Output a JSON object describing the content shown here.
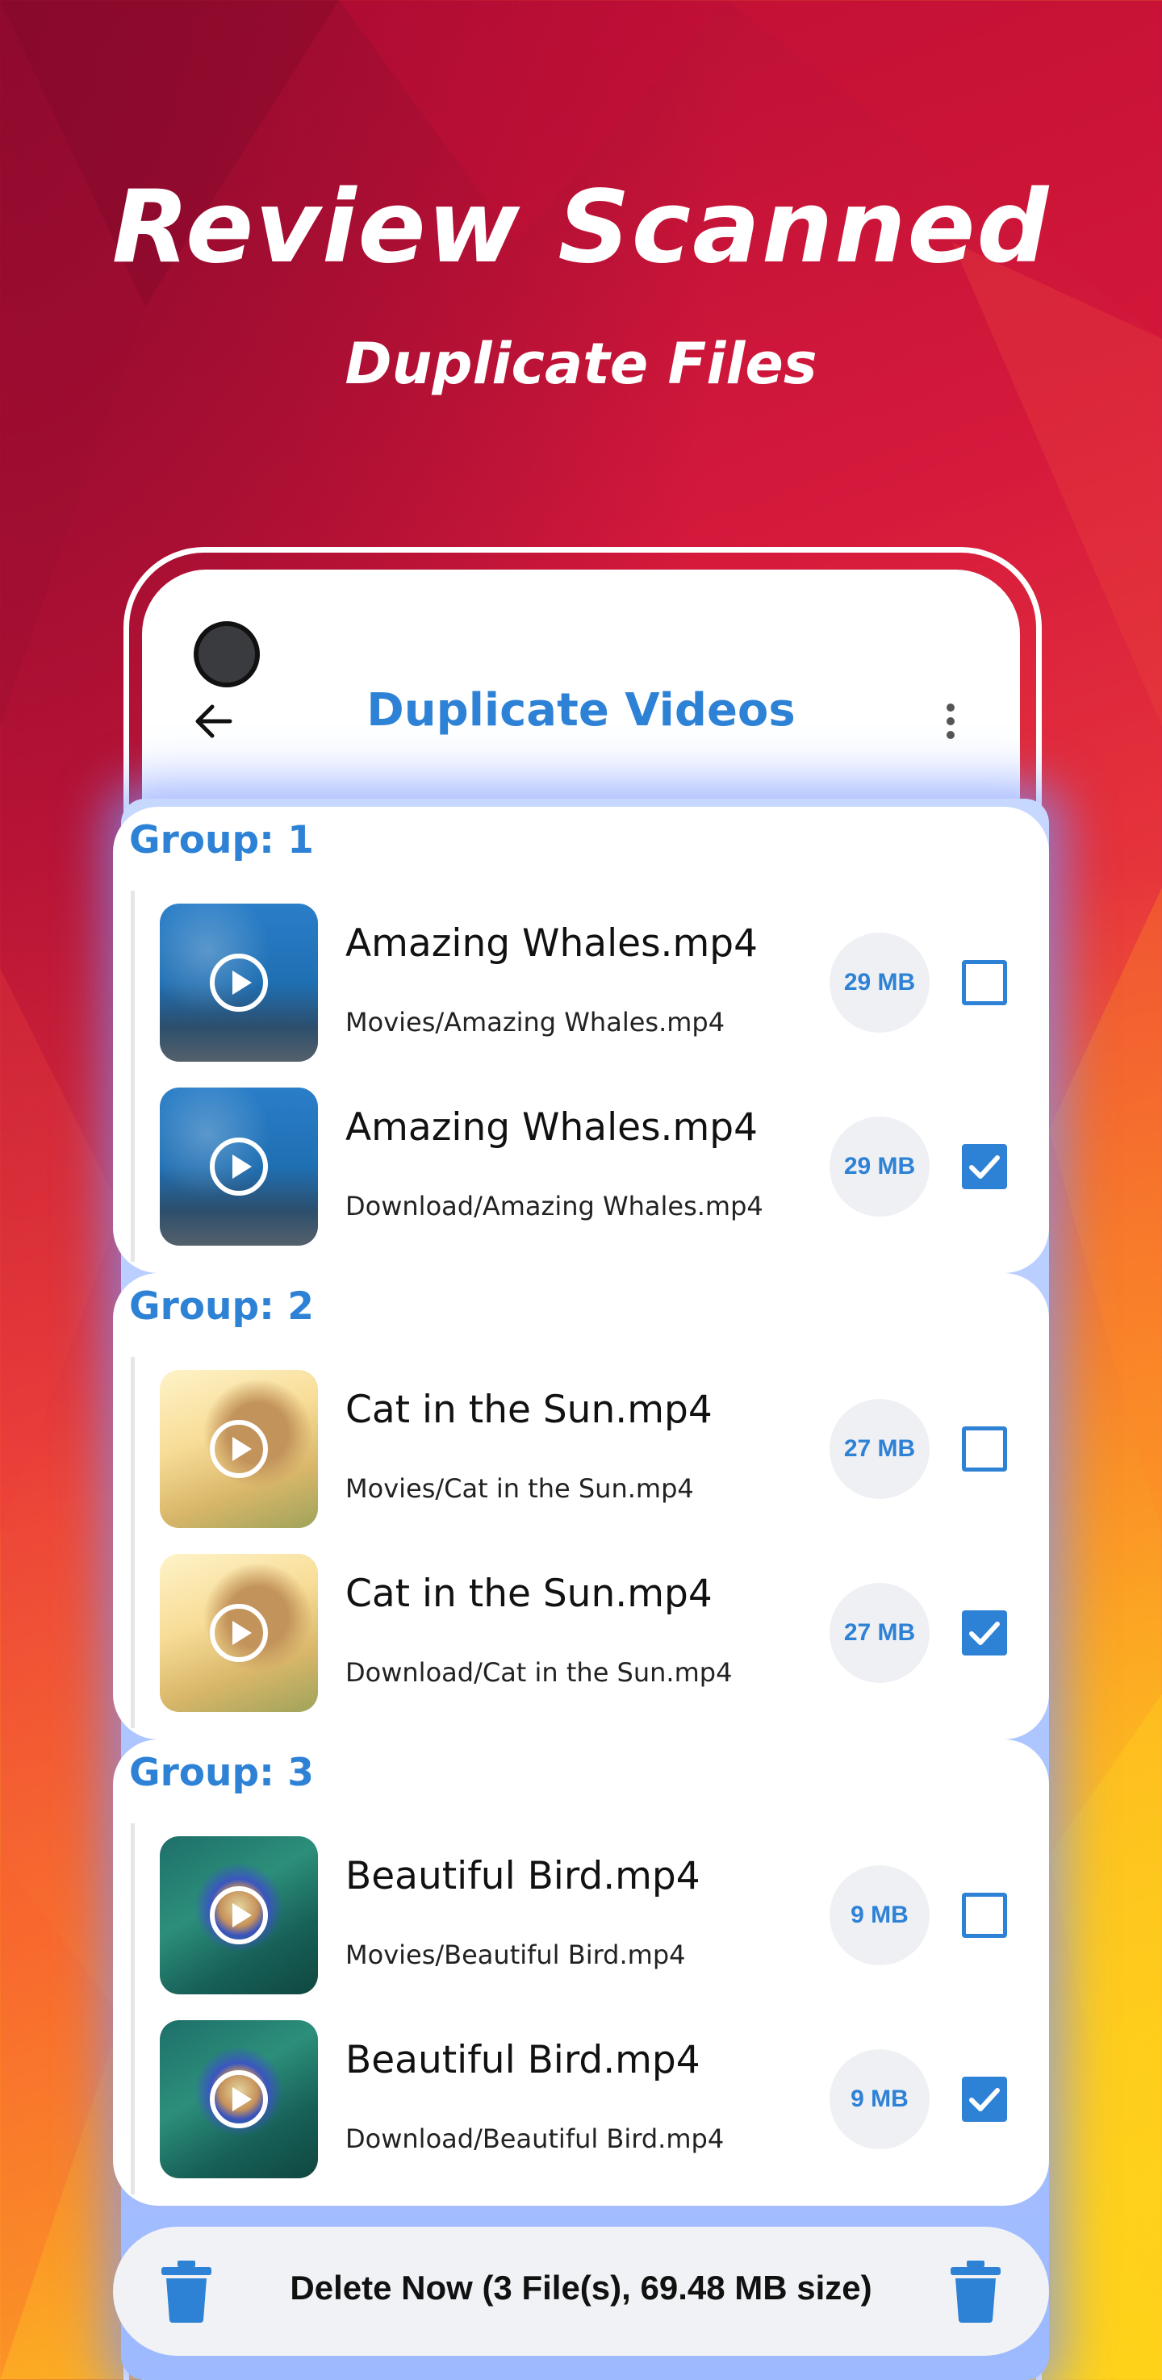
{
  "promo": {
    "headline": "Review Scanned",
    "subheadline": "Duplicate Files"
  },
  "app_bar": {
    "title": "Duplicate Videos",
    "back_icon": "back-arrow-icon",
    "menu_icon": "more-vertical-icon"
  },
  "groups": [
    {
      "label": "Group: 1",
      "files": [
        {
          "name": "Amazing Whales.mp4",
          "path": "Movies/Amazing Whales.mp4",
          "size": "29 MB",
          "checked": false,
          "thumb": "whale"
        },
        {
          "name": "Amazing Whales.mp4",
          "path": "Download/Amazing Whales.mp4",
          "size": "29 MB",
          "checked": true,
          "thumb": "whale"
        }
      ]
    },
    {
      "label": "Group: 2",
      "files": [
        {
          "name": "Cat in the Sun.mp4",
          "path": "Movies/Cat in the Sun.mp4",
          "size": "27 MB",
          "checked": false,
          "thumb": "cat"
        },
        {
          "name": "Cat in the Sun.mp4",
          "path": "Download/Cat in the Sun.mp4",
          "size": "27 MB",
          "checked": true,
          "thumb": "cat"
        }
      ]
    },
    {
      "label": "Group: 3",
      "files": [
        {
          "name": "Beautiful Bird.mp4",
          "path": "Movies/Beautiful Bird.mp4",
          "size": "9 MB",
          "checked": false,
          "thumb": "bird"
        },
        {
          "name": "Beautiful Bird.mp4",
          "path": "Download/Beautiful Bird.mp4",
          "size": "9 MB",
          "checked": true,
          "thumb": "bird"
        }
      ]
    }
  ],
  "delete_bar": {
    "label": "Delete Now (3 File(s), 69.48 MB size)",
    "icon": "trash-icon"
  },
  "colors": {
    "accent": "#2e82d6",
    "badge_bg": "#eff0f4"
  }
}
